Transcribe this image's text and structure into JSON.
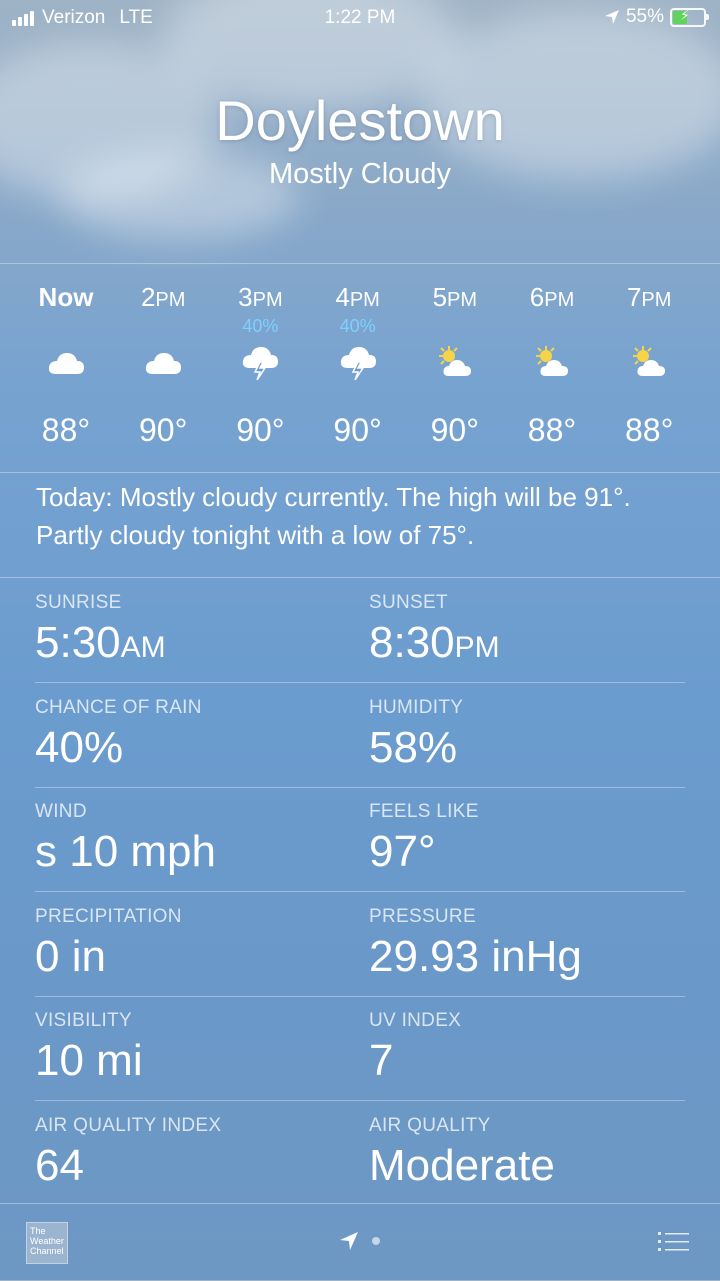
{
  "status": {
    "carrier": "Verizon",
    "network": "LTE",
    "time": "1:22 PM",
    "battery": "55%",
    "battery_level": 0.55
  },
  "header": {
    "city": "Doylestown",
    "condition": "Mostly Cloudy"
  },
  "hourly": [
    {
      "time": "Now",
      "ampm": "",
      "precip": "",
      "icon": "cloud-icon",
      "temp": "88°"
    },
    {
      "time": "2",
      "ampm": "PM",
      "precip": "",
      "icon": "cloud-icon",
      "temp": "90°"
    },
    {
      "time": "3",
      "ampm": "PM",
      "precip": "40%",
      "icon": "thunderstorm-icon",
      "temp": "90°"
    },
    {
      "time": "4",
      "ampm": "PM",
      "precip": "40%",
      "icon": "thunderstorm-icon",
      "temp": "90°"
    },
    {
      "time": "5",
      "ampm": "PM",
      "precip": "",
      "icon": "partly-sunny-icon",
      "temp": "90°"
    },
    {
      "time": "6",
      "ampm": "PM",
      "precip": "",
      "icon": "partly-sunny-icon",
      "temp": "88°"
    },
    {
      "time": "7",
      "ampm": "PM",
      "precip": "",
      "icon": "partly-sunny-icon",
      "temp": "88°"
    }
  ],
  "summary": "Today: Mostly cloudy currently. The high will be 91°. Partly cloudy tonight with a low of 75°.",
  "details": [
    {
      "left": {
        "label": "SUNRISE",
        "value": "5:30",
        "unit": "AM"
      },
      "right": {
        "label": "SUNSET",
        "value": "8:30",
        "unit": "PM"
      }
    },
    {
      "left": {
        "label": "CHANCE OF RAIN",
        "value": "40%",
        "unit": ""
      },
      "right": {
        "label": "HUMIDITY",
        "value": "58%",
        "unit": ""
      }
    },
    {
      "left": {
        "label": "WIND",
        "value": "s 10 mph",
        "unit": ""
      },
      "right": {
        "label": "FEELS LIKE",
        "value": "97°",
        "unit": ""
      }
    },
    {
      "left": {
        "label": "PRECIPITATION",
        "value": "0 in",
        "unit": ""
      },
      "right": {
        "label": "PRESSURE",
        "value": "29.93 inHg",
        "unit": ""
      }
    },
    {
      "left": {
        "label": "VISIBILITY",
        "value": "10 mi",
        "unit": ""
      },
      "right": {
        "label": "UV INDEX",
        "value": "7",
        "unit": ""
      }
    },
    {
      "left": {
        "label": "AIR QUALITY INDEX",
        "value": "64",
        "unit": ""
      },
      "right": {
        "label": "AIR QUALITY",
        "value": "Moderate",
        "unit": ""
      }
    }
  ],
  "bottom": {
    "logo_text": "The Weather Channel"
  }
}
